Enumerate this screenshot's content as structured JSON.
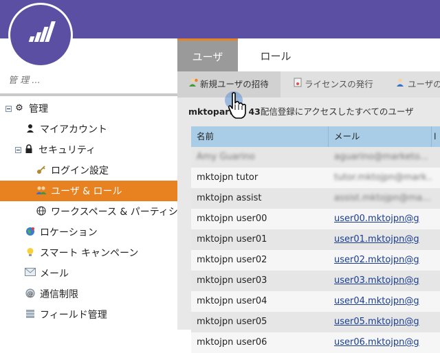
{
  "sidebar": {
    "search_placeholder": "管 理 ...",
    "items": [
      {
        "label": "管理",
        "icon": "gear-icon"
      },
      {
        "label": "マイアカウント",
        "icon": "person-icon"
      },
      {
        "label": "セキュリティ",
        "icon": "lock-icon"
      },
      {
        "label": "ログイン設定",
        "icon": "key-icon"
      },
      {
        "label": "ユーザ & ロール",
        "icon": "users-icon"
      },
      {
        "label": "ワークスペース & パーティション",
        "icon": "globe-icon"
      },
      {
        "label": "ロケーション",
        "icon": "location-globe-icon"
      },
      {
        "label": "スマート キャンペーン",
        "icon": "lightbulb-icon"
      },
      {
        "label": "メール",
        "icon": "email-icon"
      },
      {
        "label": "通信制限",
        "icon": "at-sign-icon"
      },
      {
        "label": "フィールド管理",
        "icon": "database-icon"
      }
    ]
  },
  "tabs": [
    "ユーザ",
    "ロール"
  ],
  "toolbar": {
    "invite": "新規ユーザの招待",
    "license": "ライセンスの発行",
    "user_partial": "ユーザの"
  },
  "heading": {
    "bold": "mktopart",
    "bold2": "43",
    "rest": "配信登録にアクセスしたすべてのユーザ"
  },
  "grid": {
    "columns": [
      "名前",
      "メール",
      "l"
    ],
    "rows": [
      {
        "name": "Amy Guarino",
        "email": "aguarino@marketo...",
        "blurred": true
      },
      {
        "name": "mktojpn tutor",
        "email": "tutor.mktojpn@mark...",
        "blurred_email": true
      },
      {
        "name": "mktojpn assist",
        "email": "assist.mktojpn@ma...",
        "blurred_email": true
      },
      {
        "name": "mktojpn user00",
        "email": "user00.mktojpn@g"
      },
      {
        "name": "mktojpn user01",
        "email": "user01.mktojpn@g"
      },
      {
        "name": "mktojpn user02",
        "email": "user02.mktojpn@g"
      },
      {
        "name": "mktojpn user03",
        "email": "user03.mktojpn@g"
      },
      {
        "name": "mktojpn user04",
        "email": "user04.mktojpn@g"
      },
      {
        "name": "mktojpn user05",
        "email": "user05.mktojpn@g"
      },
      {
        "name": "mktojpn user06",
        "email": "user06.mktojpn@g"
      }
    ]
  },
  "colors": {
    "topbar": "#5a4fa2",
    "accent": "#e8811f",
    "grid_header": "#a9cde6"
  }
}
